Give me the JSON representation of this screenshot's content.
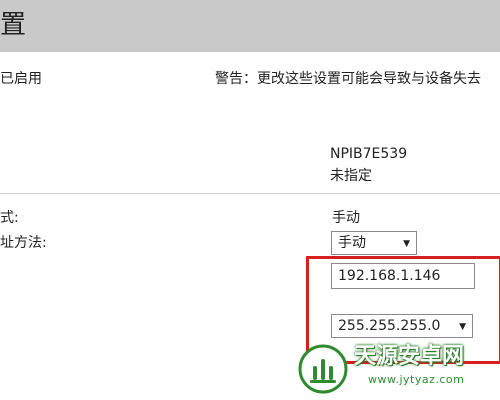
{
  "header": {
    "title": "置"
  },
  "status_text": "已启用",
  "warning_text": "警告：更改这些设置可能会导致与设备失去",
  "device": {
    "name": "NPIB7E539",
    "location": "未指定"
  },
  "config": {
    "mode_label": "式:",
    "mode_value": "手动",
    "method_label": "址方法:",
    "method_selected": "手动",
    "ip_address": "192.168.1.146",
    "subnet_mask": "255.255.255.0"
  },
  "colors": {
    "header_bg": "#c9c9c9",
    "highlight": "#d42020",
    "watermark_green": "#2e8b2e"
  },
  "watermark": {
    "name": "天源安卓网",
    "url": "www.jytyaz.com"
  }
}
